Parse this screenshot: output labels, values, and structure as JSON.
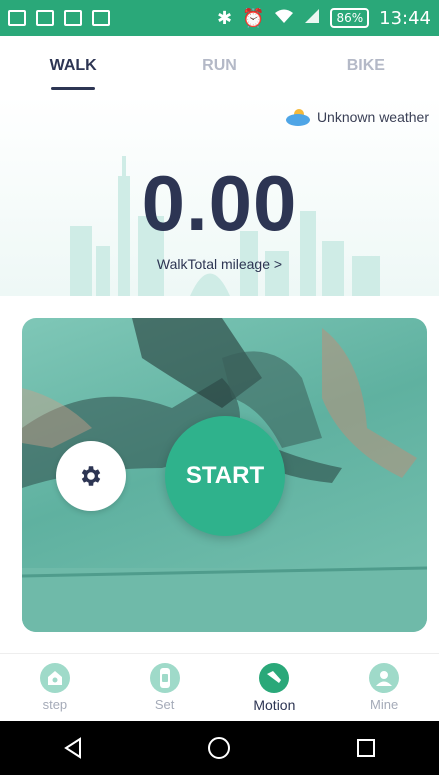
{
  "status_bar": {
    "battery": "86%",
    "time": "13:44"
  },
  "tabs": [
    {
      "label": "WALK",
      "active": true
    },
    {
      "label": "RUN",
      "active": false
    },
    {
      "label": "BIKE",
      "active": false
    }
  ],
  "weather": {
    "text": "Unknown weather",
    "icon": "cloud-sun-icon"
  },
  "mileage": {
    "value": "0.00",
    "link_label": "WalkTotal mileage >"
  },
  "actions": {
    "start_label": "START",
    "settings_icon": "gear-icon"
  },
  "bottom_nav": [
    {
      "label": "step",
      "icon": "home-icon",
      "active": false
    },
    {
      "label": "Set",
      "icon": "watch-icon",
      "active": false
    },
    {
      "label": "Motion",
      "icon": "shoe-icon",
      "active": true
    },
    {
      "label": "Mine",
      "icon": "person-icon",
      "active": false
    }
  ],
  "colors": {
    "accent": "#2aa879",
    "title": "#2d3553",
    "inactive": "#b4b9c7"
  }
}
